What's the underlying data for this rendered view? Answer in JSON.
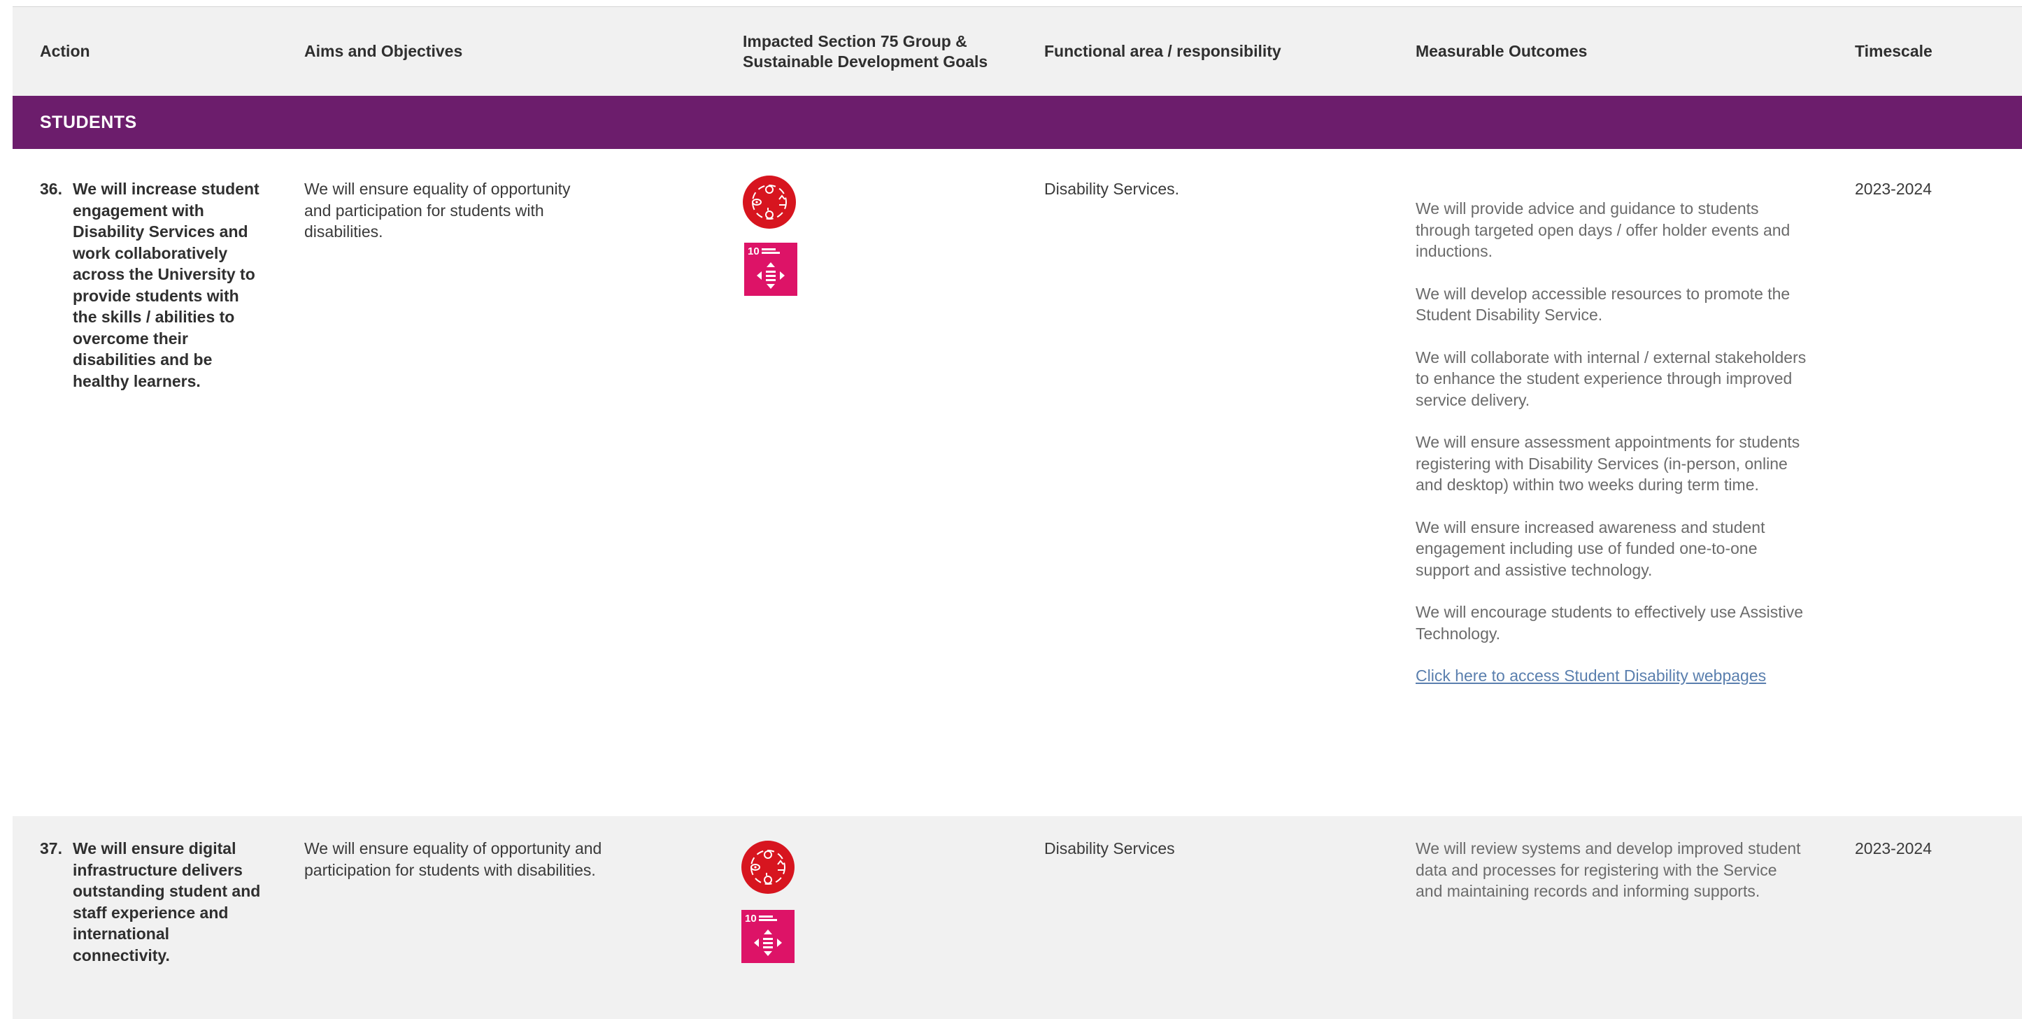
{
  "header": {
    "action": "Action",
    "aims": "Aims and Objectives",
    "impacted_line1": "Impacted Section 75 Group &",
    "impacted_line2": "Sustainable Development Goals",
    "functional": "Functional area / responsibility",
    "outcomes": "Measurable Outcomes",
    "timescale": "Timescale"
  },
  "section": {
    "label": "STUDENTS"
  },
  "rows": [
    {
      "number": "36.",
      "action": "We will increase student engagement with Disability Services and work collaboratively across the University to provide students with the skills / abilities to overcome their disabilities and be healthy learners.",
      "aims": "We will ensure equality of opportunity and participation for students with disabilities.",
      "functional": "Disability Services.",
      "outcomes": [
        "We will provide advice and guidance to students through targeted open days / offer holder events and inductions.",
        "We will develop accessible resources to promote the Student Disability Service.",
        "We will collaborate with internal / external stakeholders to enhance the student experience through improved service delivery.",
        "We will ensure assessment appointments for students registering with Disability Services (in-person, online and desktop) within two weeks during term time.",
        "We will ensure increased awareness and student engagement including use of funded one-to-one support and assistive technology.",
        "We will encourage students to effectively use Assistive Technology."
      ],
      "link_text": "Click here to access Student Disability webpages",
      "timescale": "2023-2024",
      "icons": [
        "disability-section75-icon",
        "sdg-10-reduced-inequalities-icon"
      ]
    },
    {
      "number": "37.",
      "action": "We will ensure digital infrastructure delivers outstanding student and staff experience and international connectivity.",
      "aims": "We will ensure equality of opportunity and participation for students with disabilities.",
      "functional": "Disability Services",
      "outcomes": [
        "We will review systems and develop improved student data and processes for registering with the Service and maintaining records and informing supports."
      ],
      "timescale": "2023-2024",
      "icons": [
        "disability-section75-icon",
        "sdg-10-reduced-inequalities-icon"
      ]
    }
  ],
  "sdg": {
    "number": "10",
    "title": "REDUCED INEQUALITIES"
  },
  "colors": {
    "section_band": "#6c1d6c",
    "disability_red": "#d7151f",
    "sdg10_pink": "#dd1367",
    "link": "#5a7fae"
  }
}
